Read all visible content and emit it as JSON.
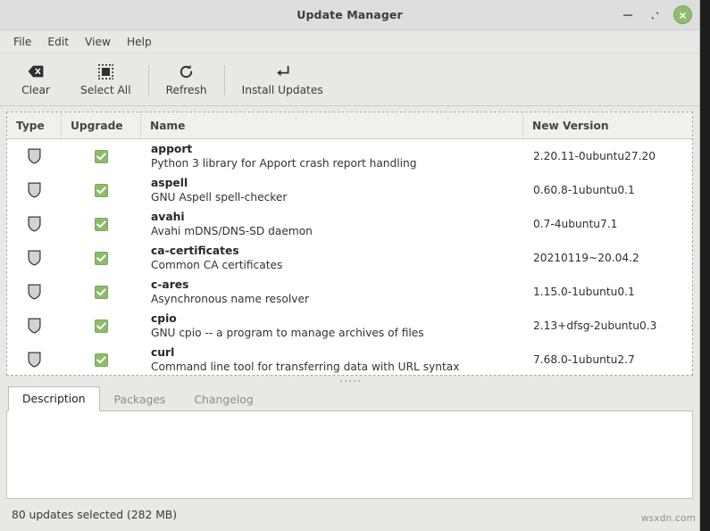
{
  "window": {
    "title": "Update Manager",
    "buttons": {
      "minimize": "minimize",
      "maximize": "maximize",
      "close": "close"
    }
  },
  "menubar": {
    "items": [
      {
        "label": "File"
      },
      {
        "label": "Edit"
      },
      {
        "label": "View"
      },
      {
        "label": "Help"
      }
    ]
  },
  "toolbar": {
    "buttons": [
      {
        "label": "Clear",
        "icon": "clear-icon"
      },
      {
        "label": "Select All",
        "icon": "select-all-icon"
      },
      {
        "label": "Refresh",
        "icon": "refresh-icon"
      },
      {
        "label": "Install Updates",
        "icon": "install-updates-icon"
      }
    ]
  },
  "table": {
    "columns": [
      {
        "label": "Type"
      },
      {
        "label": "Upgrade"
      },
      {
        "label": "Name"
      },
      {
        "label": "New Version"
      }
    ],
    "rows": [
      {
        "type_icon": "shield-icon",
        "upgrade_checked": true,
        "name": "apport",
        "description": "Python 3 library for Apport crash report handling",
        "new_version": "2.20.11-0ubuntu27.20"
      },
      {
        "type_icon": "shield-icon",
        "upgrade_checked": true,
        "name": "aspell",
        "description": "GNU Aspell spell-checker",
        "new_version": "0.60.8-1ubuntu0.1"
      },
      {
        "type_icon": "shield-icon",
        "upgrade_checked": true,
        "name": "avahi",
        "description": "Avahi mDNS/DNS-SD daemon",
        "new_version": "0.7-4ubuntu7.1"
      },
      {
        "type_icon": "shield-icon",
        "upgrade_checked": true,
        "name": "ca-certificates",
        "description": "Common CA certificates",
        "new_version": "20210119~20.04.2"
      },
      {
        "type_icon": "shield-icon",
        "upgrade_checked": true,
        "name": "c-ares",
        "description": "Asynchronous name resolver",
        "new_version": "1.15.0-1ubuntu0.1"
      },
      {
        "type_icon": "shield-icon",
        "upgrade_checked": true,
        "name": "cpio",
        "description": "GNU cpio -- a program to manage archives of files",
        "new_version": "2.13+dfsg-2ubuntu0.3"
      },
      {
        "type_icon": "shield-icon",
        "upgrade_checked": true,
        "name": "curl",
        "description": "Command line tool for transferring data with URL syntax",
        "new_version": "7.68.0-1ubuntu2.7"
      }
    ]
  },
  "details": {
    "tabs": [
      {
        "label": "Description",
        "active": true
      },
      {
        "label": "Packages",
        "active": false
      },
      {
        "label": "Changelog",
        "active": false
      }
    ],
    "panel_text": ""
  },
  "statusbar": {
    "text": "80 updates selected (282 MB)"
  },
  "watermark": {
    "text": "wsxdn.com"
  },
  "colors": {
    "window_bg": "#e8e8e7",
    "titlebar_bg": "#dedede",
    "checkbox_green": "#8cbb6a",
    "close_button_green": "#8fbc6e",
    "header_bg": "#f0f0ee",
    "panel_white": "#ffffff"
  }
}
